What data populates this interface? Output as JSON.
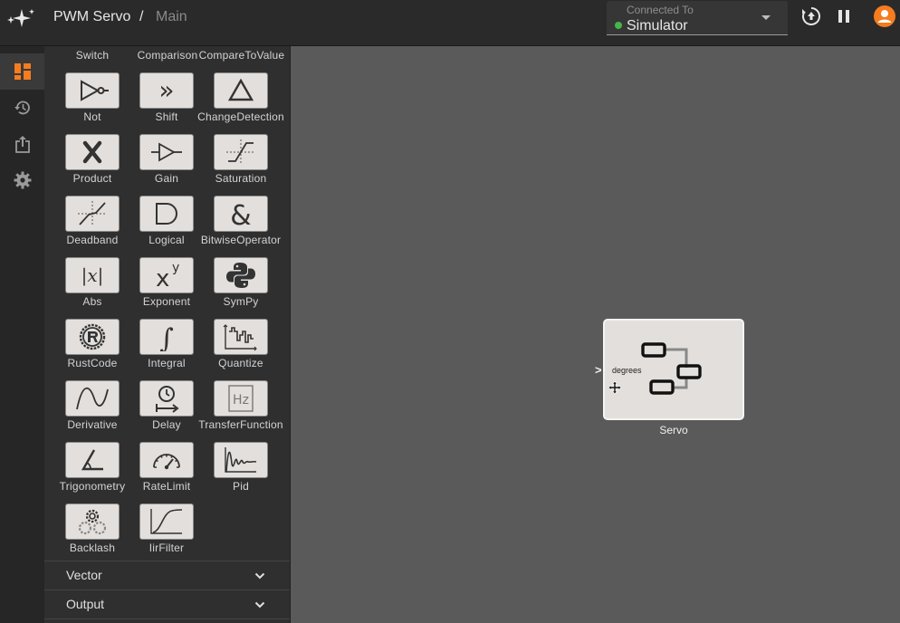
{
  "header": {
    "project": "PWM Servo",
    "separator": "/",
    "page": "Main",
    "connection": {
      "label": "Connected To",
      "value": "Simulator",
      "status_color": "#43b649"
    },
    "accent": "#f57c1f"
  },
  "rail": {
    "items": [
      {
        "icon": "blocks-icon",
        "active": true
      },
      {
        "icon": "history-icon",
        "active": false
      },
      {
        "icon": "export-icon",
        "active": false
      },
      {
        "icon": "gear-icon",
        "active": false
      }
    ]
  },
  "palette": {
    "top_labels": [
      "Switch",
      "Comparison",
      "CompareToValue"
    ],
    "blocks": [
      {
        "label": "Not",
        "icon": "not-gate-icon"
      },
      {
        "label": "Shift",
        "icon": "shift-icon"
      },
      {
        "label": "ChangeDetection",
        "icon": "triangle-icon"
      },
      {
        "label": "Product",
        "icon": "multiply-icon"
      },
      {
        "label": "Gain",
        "icon": "gain-icon"
      },
      {
        "label": "Saturation",
        "icon": "saturation-icon"
      },
      {
        "label": "Deadband",
        "icon": "deadband-icon"
      },
      {
        "label": "Logical",
        "icon": "and-gate-icon"
      },
      {
        "label": "BitwiseOperator",
        "icon": "ampersand-icon"
      },
      {
        "label": "Abs",
        "icon": "abs-icon"
      },
      {
        "label": "Exponent",
        "icon": "exponent-icon"
      },
      {
        "label": "SymPy",
        "icon": "python-icon"
      },
      {
        "label": "RustCode",
        "icon": "rust-icon"
      },
      {
        "label": "Integral",
        "icon": "integral-icon"
      },
      {
        "label": "Quantize",
        "icon": "quantize-icon"
      },
      {
        "label": "Derivative",
        "icon": "derivative-icon"
      },
      {
        "label": "Delay",
        "icon": "delay-icon"
      },
      {
        "label": "TransferFunction",
        "icon": "transfer-function-icon"
      },
      {
        "label": "Trigonometry",
        "icon": "angle-icon"
      },
      {
        "label": "RateLimit",
        "icon": "gauge-icon"
      },
      {
        "label": "Pid",
        "icon": "pid-response-icon"
      },
      {
        "label": "Backlash",
        "icon": "gears-icon"
      },
      {
        "label": "IirFilter",
        "icon": "filter-curve-icon"
      }
    ],
    "categories": [
      {
        "label": "Vector"
      },
      {
        "label": "Output"
      }
    ]
  },
  "canvas": {
    "node": {
      "name": "Servo",
      "port_label": "degrees",
      "icon": "servo-block-icon"
    }
  },
  "icon_glyphs": {
    "shift": "»",
    "multiply": "✕",
    "ampersand": "&",
    "abs": "|x|",
    "exponent": "x",
    "exponent_sup": "y",
    "integral": "∫",
    "port_caret": ">",
    "tf": "Hz"
  }
}
